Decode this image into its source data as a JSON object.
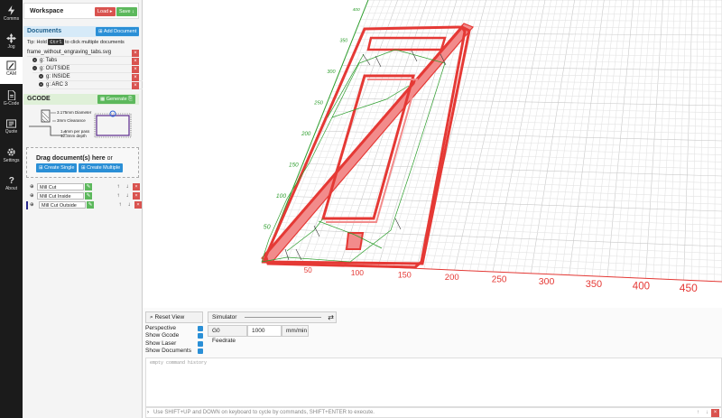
{
  "nav": [
    {
      "label": "Comms",
      "icon": "flash-icon"
    },
    {
      "label": "Jog",
      "icon": "move-icon"
    },
    {
      "label": "CAM",
      "icon": "pencil-icon"
    },
    {
      "label": "G-Code",
      "icon": "file-icon"
    },
    {
      "label": "Quote",
      "icon": "quote-icon"
    },
    {
      "label": "Settings",
      "icon": "gear-icon"
    },
    {
      "label": "About",
      "icon": "question-icon"
    }
  ],
  "workspace": {
    "title": "Workspace",
    "load_label": "Load",
    "save_label": "Save"
  },
  "documents": {
    "title": "Documents",
    "add_label": "Add Document",
    "tip_prefix": "Tip: Hold",
    "tip_key": "Ctrl",
    "tip_suffix": "to click multiple documents",
    "items": [
      {
        "label": "frame_without_engraving_tabs.svg"
      },
      {
        "label": "g: Tabs"
      },
      {
        "label": "g: OUTSIDE"
      },
      {
        "label": "g: INSIDE"
      },
      {
        "label": "g: ARC 3"
      }
    ]
  },
  "gcode": {
    "title": "GCODE",
    "generate_label": "Generate",
    "diagram": {
      "diameter": "3.175mm Diameter",
      "clearance": "3mm Clearance",
      "pass": "1.4mm per pass",
      "depth": "12.3mm depth"
    }
  },
  "drop": {
    "text": "Drag document(s) here",
    "or": "or",
    "single_label": "Create Single",
    "multiple_label": "Create Multiple"
  },
  "operations": [
    {
      "label": "Mill Cut"
    },
    {
      "label": "Mill Cut Inside"
    },
    {
      "label": "Mill Cut Outside"
    }
  ],
  "viewport": {
    "x_ticks": [
      "50",
      "100",
      "150",
      "200",
      "250",
      "300",
      "350",
      "400",
      "450"
    ],
    "y_ticks": [
      "50",
      "100",
      "150",
      "200",
      "250",
      "300",
      "350",
      "400"
    ]
  },
  "controls": {
    "reset_label": "Reset View",
    "simulator_label": "Simulator",
    "checks": [
      {
        "label": "Perspective"
      },
      {
        "label": "Show Gcode"
      },
      {
        "label": "Show Laser"
      },
      {
        "label": "Show Documents"
      }
    ],
    "feedrate_label": "G0 Feedrate",
    "feedrate_value": "1000",
    "feedrate_unit": "mm/min"
  },
  "console": {
    "placeholder": "empty command history",
    "hint": "Use SHIFT+UP and DOWN on keyboard to cycle by commands, SHIFT+ENTER to execute."
  },
  "colors": {
    "accent": "#2a8fd6",
    "danger": "#d9534f",
    "success": "#5cb85c",
    "path": "#e53935",
    "toolpath": "#2e9e2e"
  }
}
